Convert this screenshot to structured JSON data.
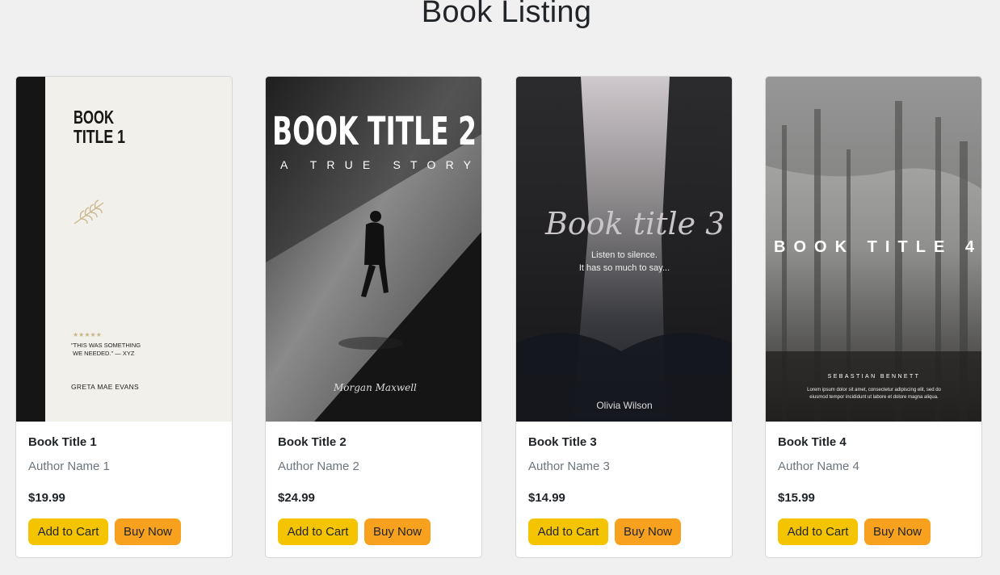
{
  "page": {
    "title": "Book Listing"
  },
  "buttons": {
    "add_to_cart": "Add to Cart",
    "buy_now": "Buy Now"
  },
  "colors": {
    "add_to_cart": "#f5c400",
    "buy_now": "#f7a11e",
    "background": "#f0f0f0"
  },
  "books": [
    {
      "title": "Book Title 1",
      "author": "Author Name 1",
      "price": "$19.99",
      "cover": {
        "title_line1": "BOOK",
        "title_line2": "TITLE 1",
        "rating": "★★★★★",
        "quote_line1": "\"THIS WAS SOMETHING",
        "quote_line2": "WE NEEDED.\" — XYZ",
        "author": "GRETA MAE EVANS"
      }
    },
    {
      "title": "Book Title 2",
      "author": "Author Name 2",
      "price": "$24.99",
      "cover": {
        "title": "BOOK TITLE 2",
        "subtitle": "A TRUE STORY",
        "author": "Morgan Maxwell"
      }
    },
    {
      "title": "Book Title 3",
      "author": "Author Name 3",
      "price": "$14.99",
      "cover": {
        "title": "Book title 3",
        "tagline1": "Listen to silence.",
        "tagline2": "It has so much to say...",
        "author": "Olivia Wilson"
      }
    },
    {
      "title": "Book Title 4",
      "author": "Author Name 4",
      "price": "$15.99",
      "cover": {
        "title": "BOOK TITLE 4",
        "author": "SEBASTIAN BENNETT",
        "blurb1": "Lorem ipsum dolor sit amet, consectetur adipiscing elit, sed do",
        "blurb2": "eiusmod tempor incididunt ut labore et dolore magna aliqua."
      }
    }
  ]
}
